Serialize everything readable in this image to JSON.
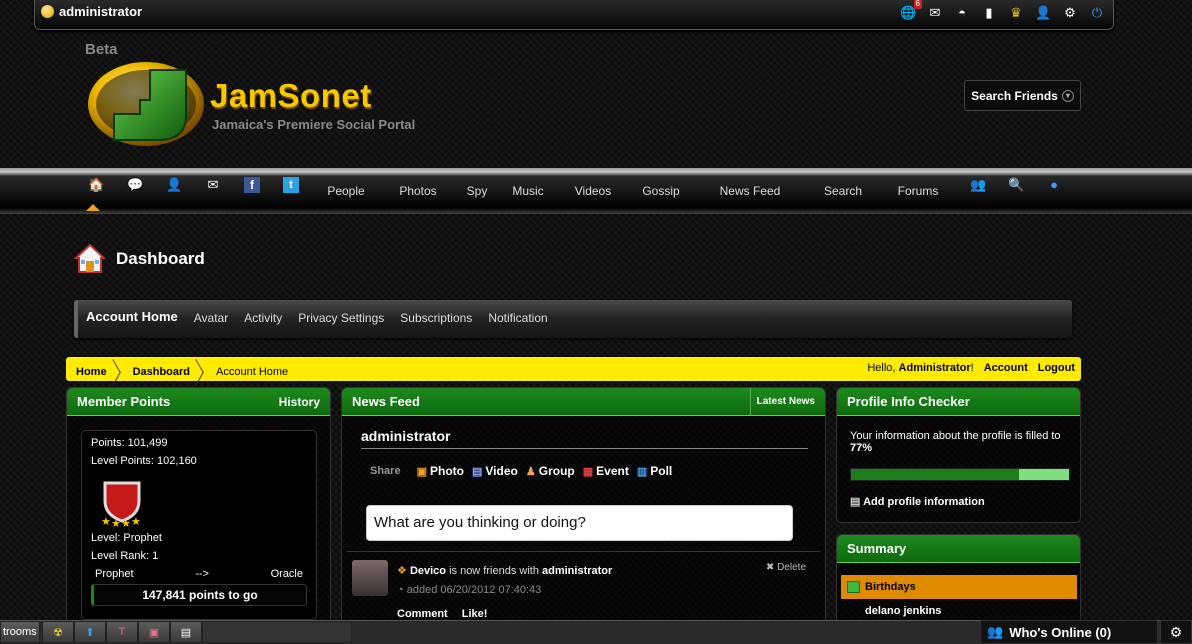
{
  "topbar": {
    "username": "administrator",
    "notification_count": "6",
    "icons": [
      "globe-notification-icon",
      "messages-icon",
      "fan-icon",
      "phone-icon",
      "crown-icon",
      "profile-icon",
      "settings-icon",
      "power-icon"
    ]
  },
  "header": {
    "beta_label": "Beta",
    "site_name": "JamSonet",
    "tagline": "Jamaica's Premiere Social Portal",
    "search_friends": "Search Friends"
  },
  "nav": {
    "links": [
      "People",
      "Photos",
      "Spy",
      "Music",
      "Videos",
      "Gossip",
      "News Feed",
      "Search",
      "Forums"
    ]
  },
  "page": {
    "title": "Dashboard"
  },
  "subnav": {
    "items": [
      "Account Home",
      "Avatar",
      "Activity",
      "Privacy Settings",
      "Subscriptions",
      "Notification"
    ]
  },
  "breadcrumb": {
    "home": "Home",
    "dashboard": "Dashboard",
    "current": "Account Home",
    "hello_prefix": "Hello, ",
    "hello_name": "Administrator",
    "hello_suffix": "!",
    "account": "Account",
    "logout": "Logout"
  },
  "member_points": {
    "title": "Member Points",
    "history": "History",
    "points": "Points: 101,499",
    "level_points": "Level Points: 102,160",
    "level": "Level: Prophet",
    "level_rank": "Level Rank: 1",
    "from_level": "Prophet",
    "arrow": "-->",
    "to_level": "Oracle",
    "to_go": "147,841 points to go"
  },
  "news_feed": {
    "title": "News Feed",
    "latest": "Latest News",
    "user": "administrator",
    "share_label": "Share",
    "share_options": [
      "Photo",
      "Video",
      "Group",
      "Event",
      "Poll"
    ],
    "status_placeholder": "What are you thinking or doing?",
    "item": {
      "actor": "Devico",
      "verb": " is now friends with ",
      "target": "administrator",
      "date": "added 06/20/2012 07:40:43",
      "delete": "Delete",
      "comment": "Comment",
      "like": "Like!"
    }
  },
  "profile_checker": {
    "title": "Profile Info Checker",
    "text": "Your information about the profile is filled to",
    "percent": "77%",
    "percent_value": 77,
    "add": "Add profile information"
  },
  "summary": {
    "title": "Summary",
    "birthdays": "Birthdays",
    "birthday_name": "delano jenkins"
  },
  "taskbar": {
    "rooms": "trooms",
    "whos_online": "Who's Online (0)"
  }
}
